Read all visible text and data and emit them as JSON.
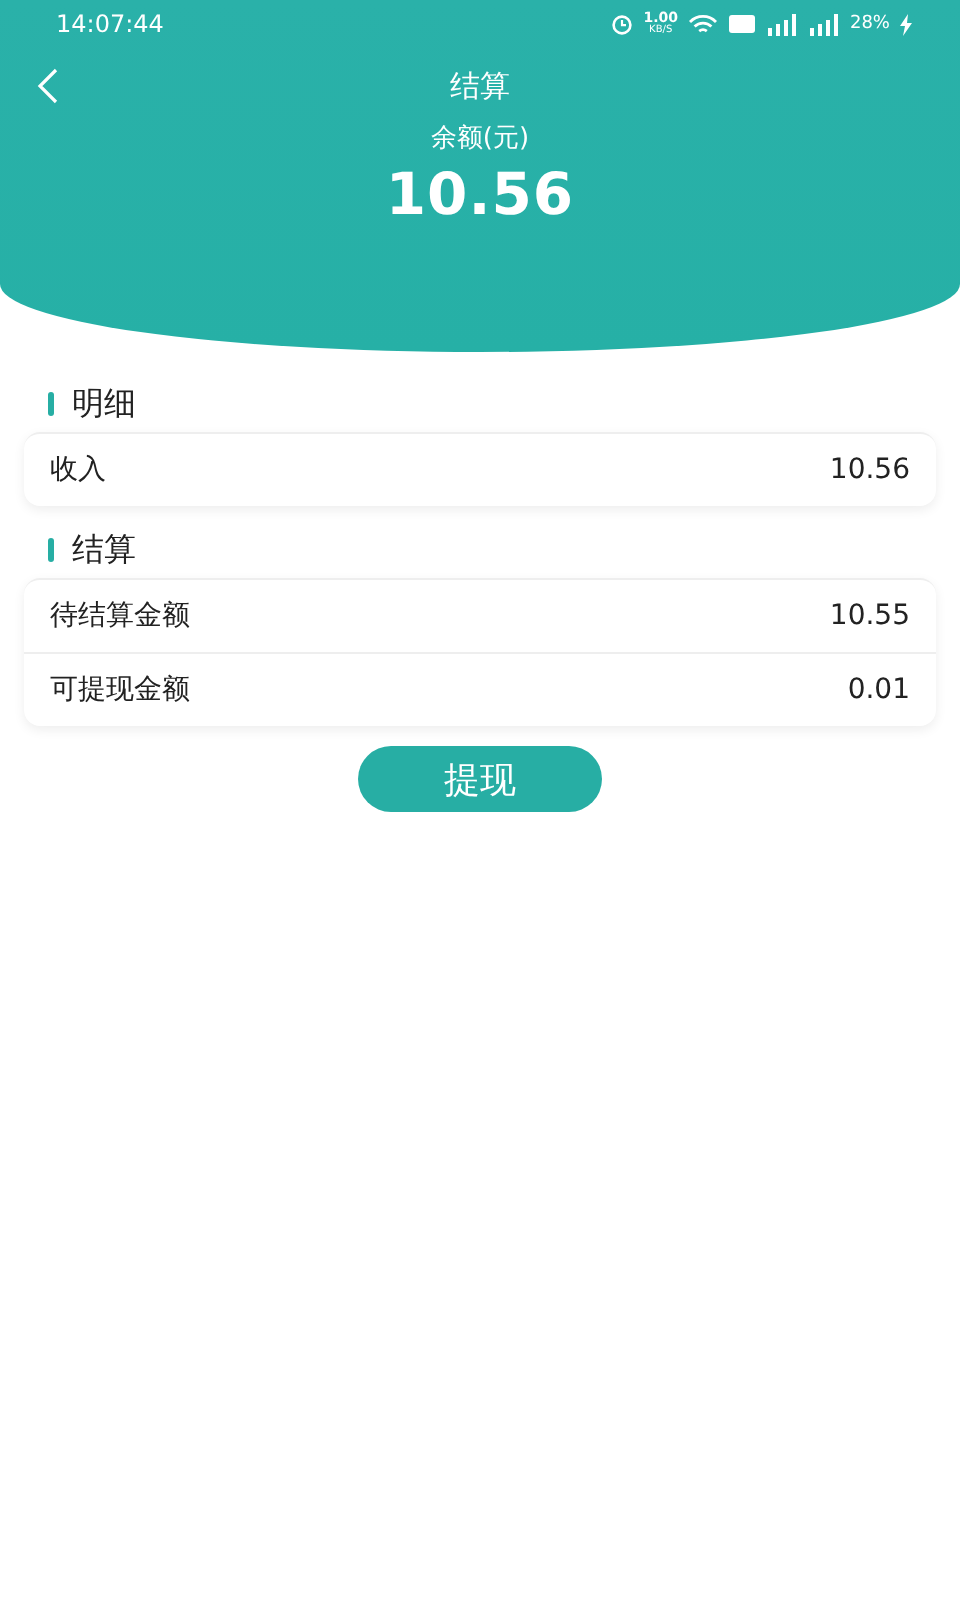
{
  "status_bar": {
    "time": "14:07:44",
    "net_speed": "1.00",
    "net_unit": "KB/S",
    "battery": "28%"
  },
  "nav": {
    "title": "结算"
  },
  "balance": {
    "label": "余额(元)",
    "amount": "10.56"
  },
  "sections": [
    {
      "title": "明细",
      "rows": [
        {
          "label": "收入",
          "value": "10.56"
        }
      ]
    },
    {
      "title": "结算",
      "rows": [
        {
          "label": "待结算金额",
          "value": "10.55"
        },
        {
          "label": "可提现金额",
          "value": "0.01"
        }
      ]
    }
  ],
  "action": {
    "label": "提现"
  }
}
